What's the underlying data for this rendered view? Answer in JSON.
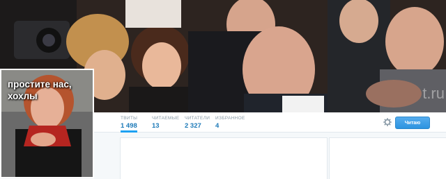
{
  "stats": [
    {
      "label": "ТВИТЫ",
      "value": "1 498"
    },
    {
      "label": "ЧИТАЕМЫЕ",
      "value": "13"
    },
    {
      "label": "ЧИТАТЕЛИ",
      "value": "2 327"
    },
    {
      "label": "ИЗБРАННОЕ",
      "value": "4"
    }
  ],
  "follow_button": "Читаю",
  "watermark": "t.ru",
  "avatar_caption": "простите нас, хохлы",
  "colors": {
    "accent": "#1da1f2",
    "count_blue": "#1d7ab8",
    "page_bg": "#f5f8fa"
  },
  "icons": {
    "settings": "gear-icon"
  }
}
